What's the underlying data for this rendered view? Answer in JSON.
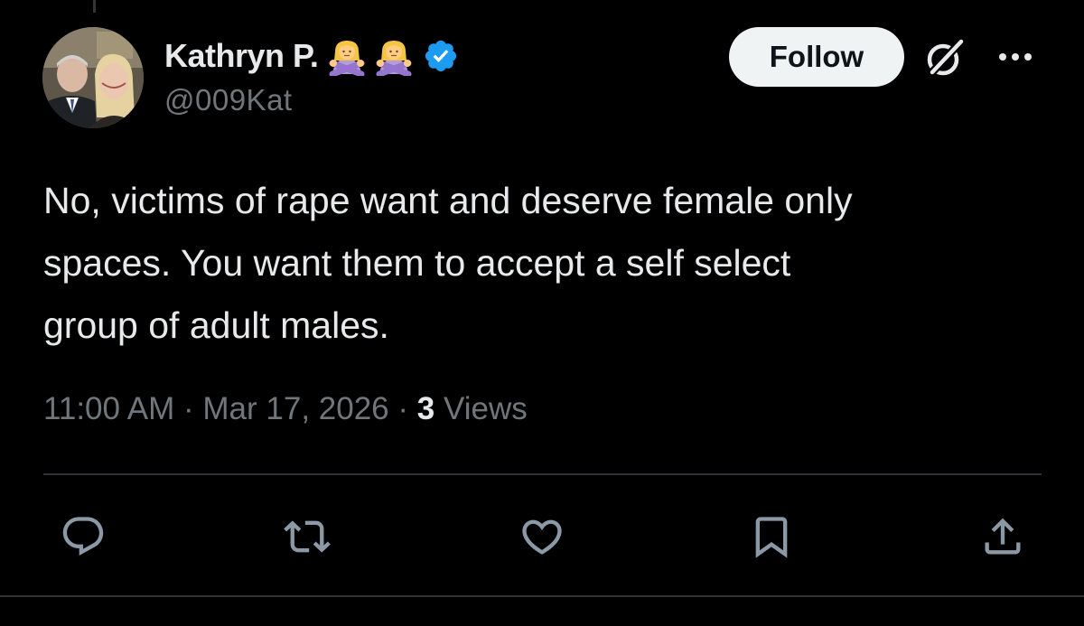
{
  "tweet": {
    "author": {
      "display_name": "Kathryn P.",
      "handle": "@009Kat",
      "emojis": [
        "person-gesturing-no-emoji",
        "person-gesturing-no-emoji"
      ],
      "verified": true,
      "verified_color": "#1d9bf0"
    },
    "follow_label": "Follow",
    "text_lines": [
      "No, victims of rape want and deserve female only",
      "spaces. You want them to accept a self select",
      "group of adult males."
    ],
    "meta": {
      "time": "11:00 AM",
      "separator": "·",
      "date": "Mar 17, 2026",
      "views_count": "3",
      "views_label": "Views"
    },
    "actions": [
      "reply-icon",
      "retweet-icon",
      "like-icon",
      "bookmark-icon",
      "share-icon"
    ]
  },
  "colors": {
    "background": "#000000",
    "text_primary": "#e7e9ea",
    "text_secondary": "#71767b",
    "divider": "#2f3336",
    "follow_bg": "#eff3f4",
    "follow_text": "#0f1419"
  }
}
